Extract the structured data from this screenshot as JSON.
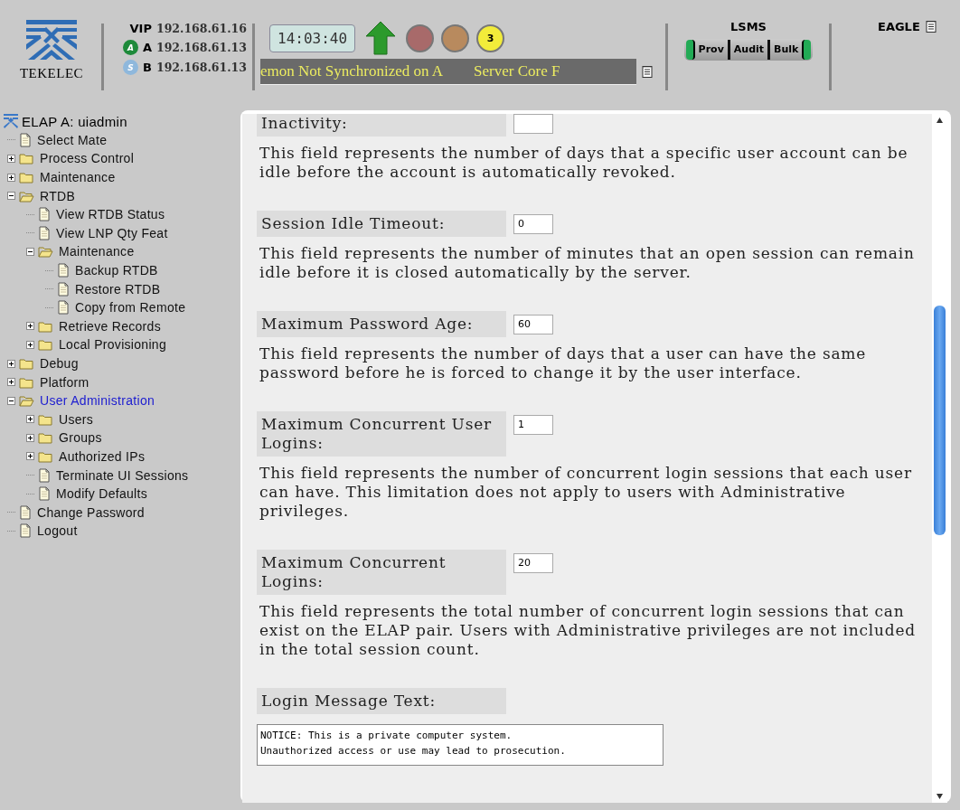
{
  "header": {
    "logo": "TEKELEC",
    "servers": [
      {
        "label": "VIP",
        "ip": "192.168.61.16"
      },
      {
        "badge": "A",
        "color": "#1e8a3a",
        "label": "A",
        "ip": "192.168.61.13"
      },
      {
        "badge": "S",
        "color": "#8fb8dc",
        "label": "B",
        "ip": "192.168.61.13"
      }
    ],
    "clock": "14:03:40",
    "alarms": [
      {
        "color": "#a86a6a"
      },
      {
        "color": "#b88a5e"
      },
      {
        "color": "#f2ec3a",
        "count": "3"
      }
    ],
    "ticker": [
      "emon Not Synchronized on A",
      "Server Core F"
    ],
    "lsms": {
      "title": "LSMS",
      "buttons": [
        "Prov",
        "Audit",
        "Bulk"
      ]
    },
    "eagle": {
      "title": "EAGLE"
    }
  },
  "sidebar": {
    "title": "ELAP A: uiadmin",
    "items": [
      {
        "label": "Select Mate",
        "kind": "page",
        "selected": false
      },
      {
        "label": "Process Control",
        "kind": "folder",
        "expanded": false,
        "selected": false
      },
      {
        "label": "Maintenance",
        "kind": "folder",
        "expanded": false,
        "selected": false
      },
      {
        "label": "RTDB",
        "kind": "folder",
        "expanded": true,
        "selected": false,
        "children": [
          {
            "label": "View RTDB Status",
            "kind": "page",
            "selected": false
          },
          {
            "label": "View LNP Qty Feat",
            "kind": "page",
            "selected": false
          },
          {
            "label": "Maintenance",
            "kind": "folder",
            "expanded": true,
            "selected": false,
            "children": [
              {
                "label": "Backup RTDB",
                "kind": "page",
                "selected": false
              },
              {
                "label": "Restore RTDB",
                "kind": "page",
                "selected": false
              },
              {
                "label": "Copy from Remote",
                "kind": "page",
                "selected": false
              }
            ]
          },
          {
            "label": "Retrieve Records",
            "kind": "folder",
            "expanded": false,
            "selected": false
          },
          {
            "label": "Local Provisioning",
            "kind": "folder",
            "expanded": false,
            "selected": false
          }
        ]
      },
      {
        "label": "Debug",
        "kind": "folder",
        "expanded": false,
        "selected": false
      },
      {
        "label": "Platform",
        "kind": "folder",
        "expanded": false,
        "selected": false
      },
      {
        "label": "User Administration",
        "kind": "folder",
        "expanded": true,
        "selected": true,
        "children": [
          {
            "label": "Users",
            "kind": "folder",
            "expanded": false,
            "selected": false
          },
          {
            "label": "Groups",
            "kind": "folder",
            "expanded": false,
            "selected": false
          },
          {
            "label": "Authorized IPs",
            "kind": "folder",
            "expanded": false,
            "selected": false
          },
          {
            "label": "Terminate UI Sessions",
            "kind": "page",
            "selected": false
          },
          {
            "label": "Modify Defaults",
            "kind": "page",
            "selected": false
          }
        ]
      },
      {
        "label": "Change Password",
        "kind": "page",
        "selected": false
      },
      {
        "label": "Logout",
        "kind": "page",
        "selected": false
      }
    ]
  },
  "form": {
    "fields": [
      {
        "kind": "number",
        "label": "Inactivity:",
        "description": "This field represents the number of days that a specific user account can be idle before the account is automatically revoked."
      },
      {
        "kind": "number",
        "label": "Session Idle Timeout:",
        "value": "0",
        "description": "This field represents the number of minutes that an open session can remain idle before it is closed automatically by the server."
      },
      {
        "kind": "number",
        "label": "Maximum Password Age:",
        "value": "60",
        "description": "This field represents the number of days that a user can have the same password before he is forced to change it by the user interface."
      },
      {
        "kind": "number",
        "label": "Maximum Concurrent User Logins:",
        "value": "1",
        "description": "This field represents the number of concurrent login sessions that each user can have. This limitation does not apply to users with Administrative privileges."
      },
      {
        "kind": "number",
        "label": "Maximum Concurrent Logins:",
        "value": "20",
        "description": "This field represents the total number of concurrent login sessions that can exist on the ELAP pair. Users with Administrative privileges are not included in the total session count."
      },
      {
        "kind": "text",
        "label": "Login Message Text:",
        "value": "NOTICE: This is a private computer system.\nUnauthorized access or use may lead to prosecution."
      }
    ]
  }
}
